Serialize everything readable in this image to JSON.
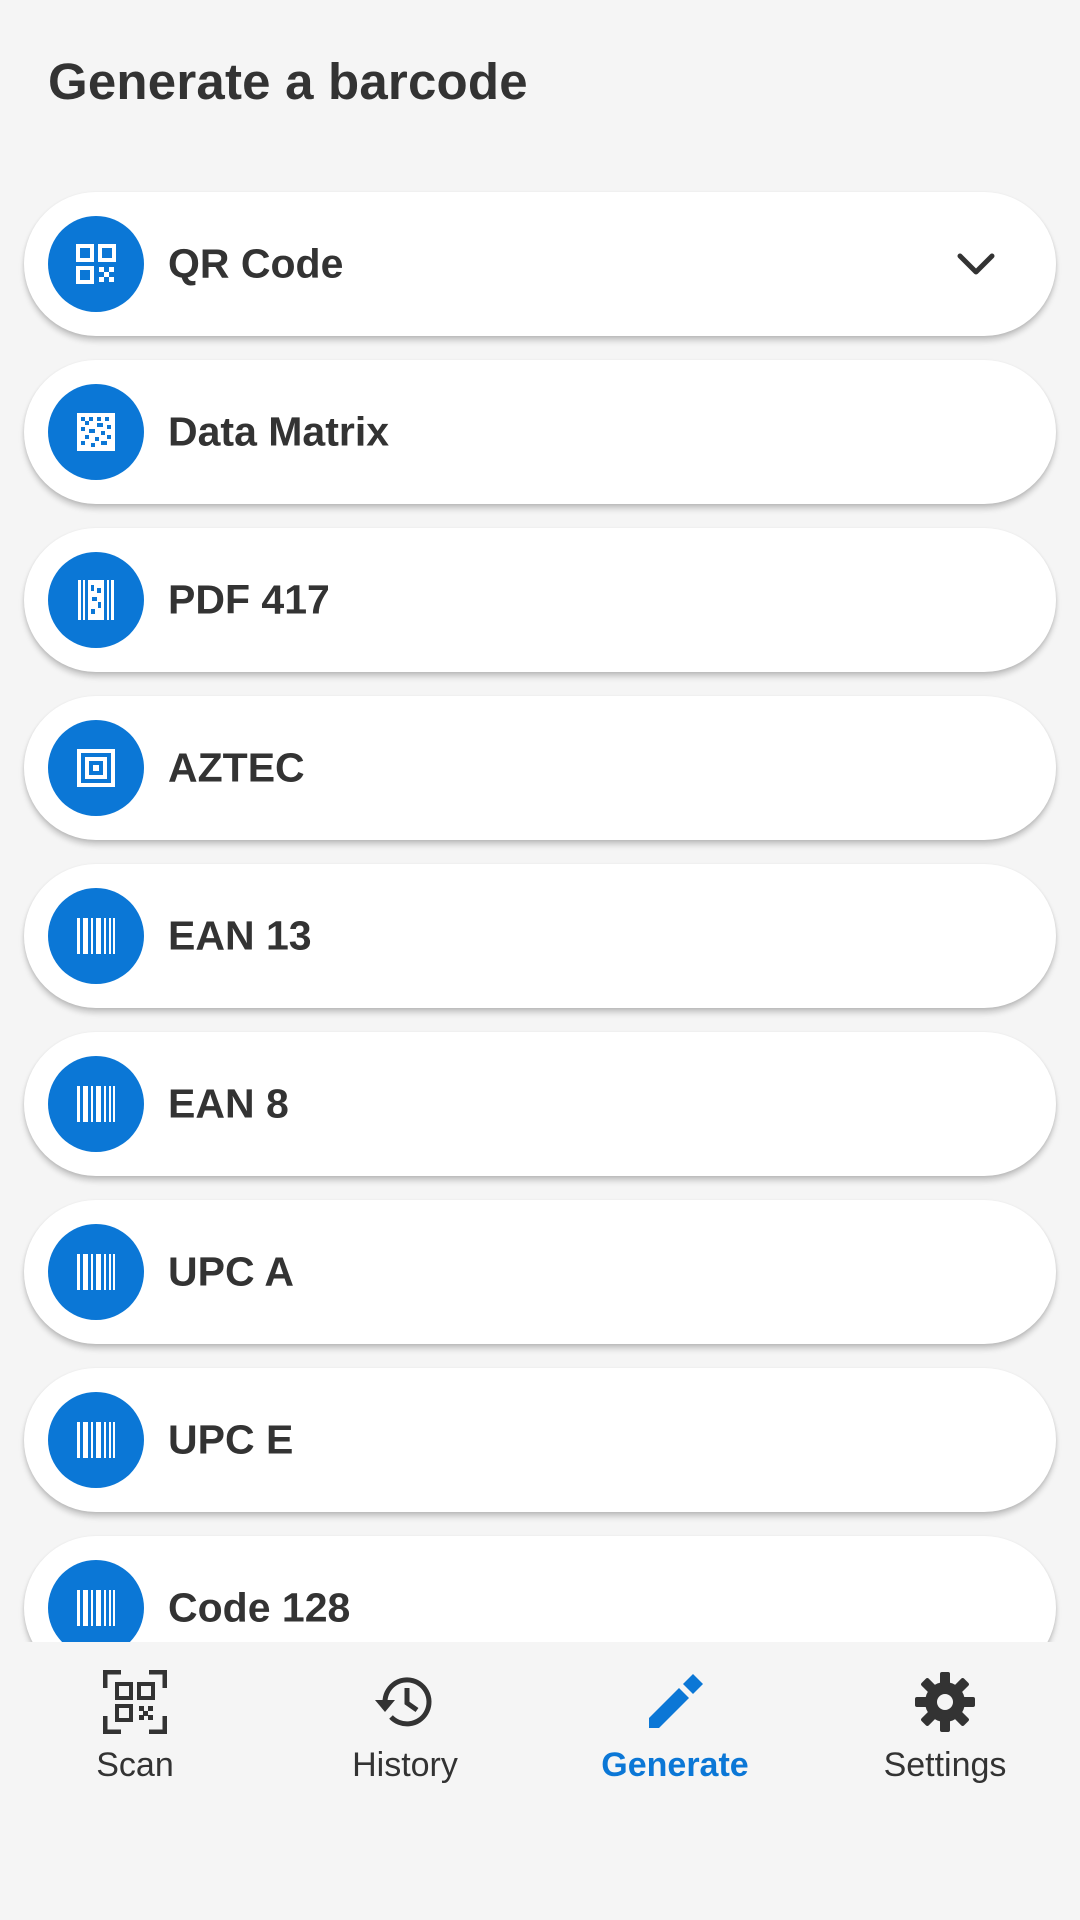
{
  "header": {
    "title": "Generate a barcode"
  },
  "barcode_types": [
    {
      "label": "QR Code",
      "icon": "qr-code-icon",
      "expanded_indicator": "chevron-down-icon"
    },
    {
      "label": "Data Matrix",
      "icon": "data-matrix-icon"
    },
    {
      "label": "PDF 417",
      "icon": "pdf417-icon"
    },
    {
      "label": "AZTEC",
      "icon": "aztec-icon"
    },
    {
      "label": "EAN 13",
      "icon": "barcode-icon"
    },
    {
      "label": "EAN 8",
      "icon": "barcode-icon"
    },
    {
      "label": "UPC A",
      "icon": "barcode-icon"
    },
    {
      "label": "UPC E",
      "icon": "barcode-icon"
    },
    {
      "label": "Code 128",
      "icon": "barcode-icon"
    }
  ],
  "bottom_nav": {
    "items": [
      {
        "label": "Scan",
        "icon": "qr-scan-icon",
        "active": false
      },
      {
        "label": "History",
        "icon": "history-icon",
        "active": false
      },
      {
        "label": "Generate",
        "icon": "pencil-icon",
        "active": true
      },
      {
        "label": "Settings",
        "icon": "gear-icon",
        "active": false
      }
    ]
  },
  "colors": {
    "accent": "#0b77d6",
    "text": "#333333",
    "background": "#f5f5f5",
    "card": "#ffffff"
  }
}
